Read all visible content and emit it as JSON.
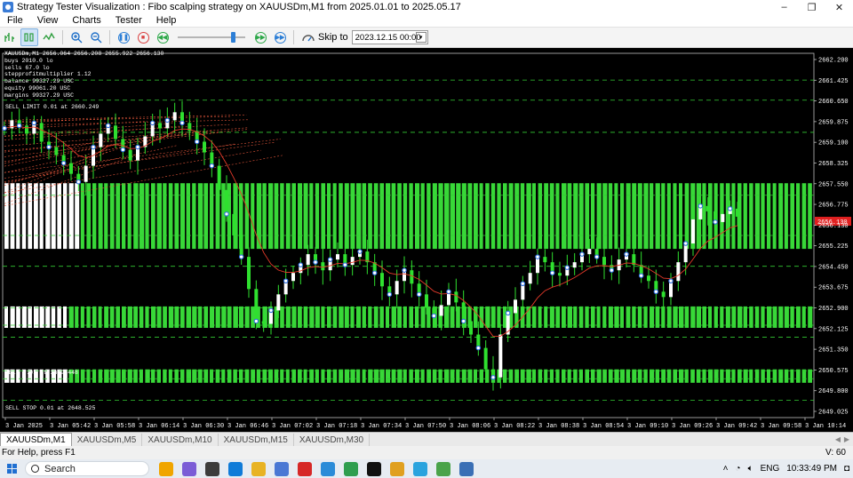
{
  "window": {
    "title": "Strategy Tester Visualization : Fibo scalping strategy on XAUUSDm,M1 from 2025.01.01 to 2025.05.17",
    "controls": [
      "–",
      "❐",
      "✕"
    ]
  },
  "menu": [
    "File",
    "View",
    "Charts",
    "Tester",
    "Help"
  ],
  "toolbar": {
    "skip_label": "Skip to",
    "skip_date": "2023.12.15 00:00",
    "speed_fraction": 0.85
  },
  "info_panel": [
    "XAUUSDm,M1  2656.064 2656.208 2655.922 2656.130",
    "buys 2010.0 lo",
    "sells 67.0 lo",
    "stepprofitmultiplier 1.12",
    "balance 99327.29 USC",
    "equity 99061.20 USC",
    "margins 99327.29 USC"
  ],
  "order_labels": {
    "sell_limit_top": "SELL LIMIT 0.01 at 2660.249",
    "sell_mid": "SELL 0.01 at 2649.448",
    "sell_stop": "SELL STOP 0.01 at 2648.525"
  },
  "chart_data": {
    "type": "candlestick",
    "symbol": "XAUUSDm,M1",
    "price_ticks": [
      "2662.200",
      "2661.425",
      "2660.650",
      "2659.875",
      "2659.100",
      "2658.325",
      "2657.550",
      "2656.775",
      "2656.130",
      "2655.225",
      "2654.450",
      "2653.675",
      "2652.900",
      "2652.125",
      "2651.350",
      "2650.575",
      "2649.800",
      "2649.025"
    ],
    "time_ticks": [
      "3 Jan 2025",
      "3 Jan 05:42",
      "3 Jan 05:58",
      "3 Jan 06:14",
      "3 Jan 06:30",
      "3 Jan 06:46",
      "3 Jan 07:02",
      "3 Jan 07:18",
      "3 Jan 07:34",
      "3 Jan 07:50",
      "3 Jan 08:06",
      "3 Jan 08:22",
      "3 Jan 08:38",
      "3 Jan 08:54",
      "3 Jan 09:10",
      "3 Jan 09:26",
      "3 Jan 09:42",
      "3 Jan 09:58",
      "3 Jan 10:14"
    ],
    "ylim": [
      2648.8,
      2662.4
    ],
    "current_price": 2656.13,
    "order_levels": [
      2661.4,
      2660.65,
      2659.45,
      2657.1,
      2655.6,
      2654.45,
      2652.9,
      2652.25,
      2651.8,
      2650.55,
      2650.25,
      2649.45
    ],
    "close_path": [
      2659.6,
      2659.9,
      2659.7,
      2659.4,
      2659.8,
      2659.1,
      2658.9,
      2658.6,
      2658.3,
      2657.9,
      2657.6,
      2658.2,
      2658.9,
      2659.4,
      2659.7,
      2659.2,
      2658.8,
      2658.4,
      2658.9,
      2659.3,
      2659.8,
      2659.6,
      2659.9,
      2660.2,
      2659.8,
      2659.5,
      2659.1,
      2658.7,
      2658.2,
      2657.3,
      2656.4,
      2655.6,
      2654.8,
      2653.6,
      2652.4,
      2652.3,
      2652.8,
      2653.4,
      2653.9,
      2654.2,
      2654.5,
      2654.9,
      2654.6,
      2654.3,
      2654.7,
      2654.9,
      2654.5,
      2654.8,
      2655.0,
      2654.6,
      2654.2,
      2653.7,
      2653.4,
      2653.9,
      2654.3,
      2653.8,
      2653.4,
      2652.9,
      2652.6,
      2653.0,
      2653.5,
      2653.1,
      2652.4,
      2651.9,
      2651.4,
      2650.6,
      2650.3,
      2651.9,
      2652.7,
      2653.2,
      2653.8,
      2654.2,
      2654.8,
      2654.6,
      2654.2,
      2654.1,
      2654.4,
      2654.6,
      2654.9,
      2655.1,
      2654.8,
      2654.5,
      2654.3,
      2654.7,
      2654.9,
      2654.5,
      2654.1,
      2653.9,
      2653.5,
      2653.3,
      2653.9,
      2654.6,
      2655.3,
      2656.2,
      2656.7,
      2656.5,
      2656.1,
      2656.4,
      2656.6,
      2656.3
    ]
  },
  "tabs": [
    "XAUUSDm,M1",
    "XAUUSDm,M5",
    "XAUUSDm,M10",
    "XAUUSDm,M15",
    "XAUUSDm,M30"
  ],
  "status": {
    "help": "For Help, press F1",
    "volume": "V: 60"
  },
  "taskbar": {
    "search_placeholder": "Search",
    "apps": [
      {
        "icon": "widgets-icon",
        "color": "#f0a500"
      },
      {
        "icon": "copilot-icon",
        "color": "#7a5cd6"
      },
      {
        "icon": "calculator-icon",
        "color": "#3c3c3c"
      },
      {
        "icon": "edge-icon",
        "color": "#0f7bd8"
      },
      {
        "icon": "file-explorer-icon",
        "color": "#e8b324"
      },
      {
        "icon": "photos-icon",
        "color": "#4a78d4"
      },
      {
        "icon": "opera-icon",
        "color": "#d62828"
      },
      {
        "icon": "store-icon",
        "color": "#2a8bd8"
      },
      {
        "icon": "chrome-icon",
        "color": "#2e9e4f"
      },
      {
        "icon": "tradingview-icon",
        "color": "#111111"
      },
      {
        "icon": "emoji-app-icon",
        "color": "#e0a020"
      },
      {
        "icon": "telegram-icon",
        "color": "#2aa3de"
      },
      {
        "icon": "metatrader-icon",
        "color": "#4aa34a"
      },
      {
        "icon": "settings-icon",
        "color": "#3a6fb5"
      }
    ],
    "language": "ENG",
    "time": "10:33:49 PM"
  }
}
